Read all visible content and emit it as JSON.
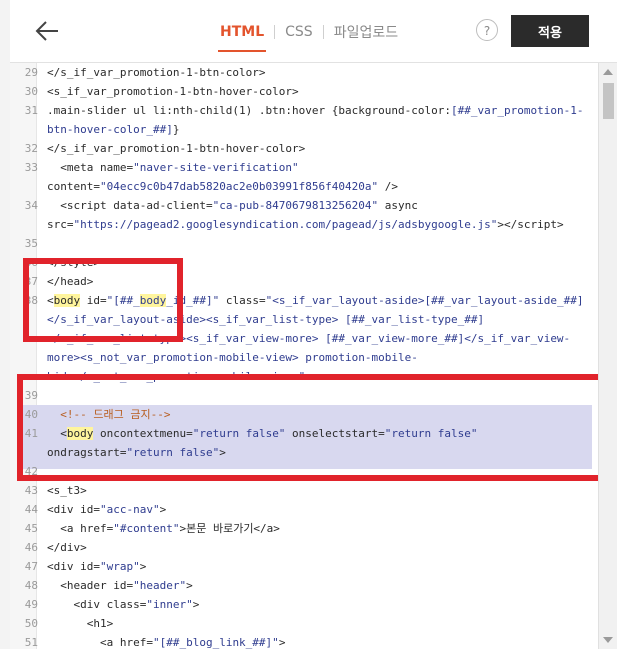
{
  "header": {
    "back_icon": "arrow-left-icon",
    "tabs": [
      {
        "label": "HTML",
        "active": true
      },
      {
        "label": "CSS",
        "active": false
      },
      {
        "label": "파일업로드",
        "active": false
      }
    ],
    "help_label": "?",
    "apply_label": "적용"
  },
  "editor": {
    "lines": [
      {
        "num": "29",
        "html": "&lt;/s_if_var_promotion-1-btn-color&gt;"
      },
      {
        "num": "30",
        "html": "&lt;s_if_var_promotion-1-btn-hover-color&gt;"
      },
      {
        "num": "31",
        "html": ".main-slider ul li:nth-child(1) .btn:hover {background-color:<span class=\"val\">[##_var_promotion-1-</span>"
      },
      {
        "num": "",
        "html": "<span class=\"val\">btn-hover-color_##]</span>}"
      },
      {
        "num": "32",
        "html": "&lt;/s_if_var_promotion-1-btn-hover-color&gt;"
      },
      {
        "num": "33",
        "html": "  &lt;meta name=<span class=\"val\">\"naver-site-verification\"</span>"
      },
      {
        "num": "",
        "html": "content=<span class=\"val\">\"04ecc9c0b47dab5820ac2e0b03991f856f40420a\"</span> /&gt;"
      },
      {
        "num": "34",
        "html": "  &lt;script data-ad-client=<span class=\"val\">\"ca-pub-8470679813256204\"</span> async"
      },
      {
        "num": "",
        "html": "src=<span class=\"val\">\"https://pagead2.googlesyndication.com/pagead/js/adsbygoogle.js\"</span>&gt;&lt;/script&gt;"
      },
      {
        "num": "35",
        "html": ""
      },
      {
        "num": "36",
        "html": "&lt;/style&gt;"
      },
      {
        "num": "37",
        "html": "&lt;/head&gt;"
      },
      {
        "num": "38",
        "html": "&lt;<span class=\"hl\">body</span> id=<span class=\"val\">\"[##_<span class=\"hl\">body</span>_id_##]\"</span> class=<span class=\"val\">\"&lt;s_if_var_layout-aside&gt;[##_var_layout-aside_##]</span>"
      },
      {
        "num": "",
        "html": "<span class=\"val\">&lt;/s_if_var_layout-aside&gt;&lt;s_if_var_list-type&gt; [##_var_list-type_##]</span>"
      },
      {
        "num": "",
        "html": "<span class=\"val\">&lt;/s_if_var_list-type&gt;&lt;s_if_var_view-more&gt; [##_var_view-more_##]&lt;/s_if_var_view-</span>"
      },
      {
        "num": "",
        "html": "<span class=\"val\">more&gt;&lt;s_not_var_promotion-mobile-view&gt; promotion-mobile-</span>"
      },
      {
        "num": "",
        "html": "<span class=\"val\">hide&lt;/s_not_var_promotion-mobile-view&gt;\"</span>&gt;"
      },
      {
        "num": "39",
        "html": ""
      },
      {
        "num": "40",
        "html": "  <span class=\"cmt\">&lt;!-- 드래그 금지--&gt;</span>"
      },
      {
        "num": "41",
        "html": "  &lt;<span class=\"hl\">body</span> oncontextmenu=<span class=\"val\">\"return false\"</span> onselectstart=<span class=\"val\">\"return false\"</span>"
      },
      {
        "num": "",
        "html": "ondragstart=<span class=\"val\">\"return false\"</span>&gt;"
      },
      {
        "num": "42",
        "html": ""
      },
      {
        "num": "43",
        "html": "&lt;s_t3&gt;"
      },
      {
        "num": "44",
        "html": "&lt;div id=<span class=\"val\">\"acc-nav\"</span>&gt;"
      },
      {
        "num": "45",
        "html": "  &lt;a href=<span class=\"val\">\"#content\"</span>&gt;본문 바로가기&lt;/a&gt;"
      },
      {
        "num": "46",
        "html": "&lt;/div&gt;"
      },
      {
        "num": "47",
        "html": "&lt;div id=<span class=\"val\">\"wrap\"</span>&gt;"
      },
      {
        "num": "48",
        "html": "  &lt;header id=<span class=\"val\">\"header\"</span>&gt;"
      },
      {
        "num": "49",
        "html": "    &lt;div class=<span class=\"val\">\"inner\"</span>&gt;"
      },
      {
        "num": "50",
        "html": "      &lt;h1&gt;"
      },
      {
        "num": "51",
        "html": "        &lt;a href=<span class=\"val\">\"[##_blog_link_##]\"</span>&gt;"
      }
    ]
  },
  "annotation_colors": {
    "box": "#e1232b",
    "selection": "#d8d8ef",
    "highlight": "#fff59d",
    "accent": "#e3542d"
  }
}
